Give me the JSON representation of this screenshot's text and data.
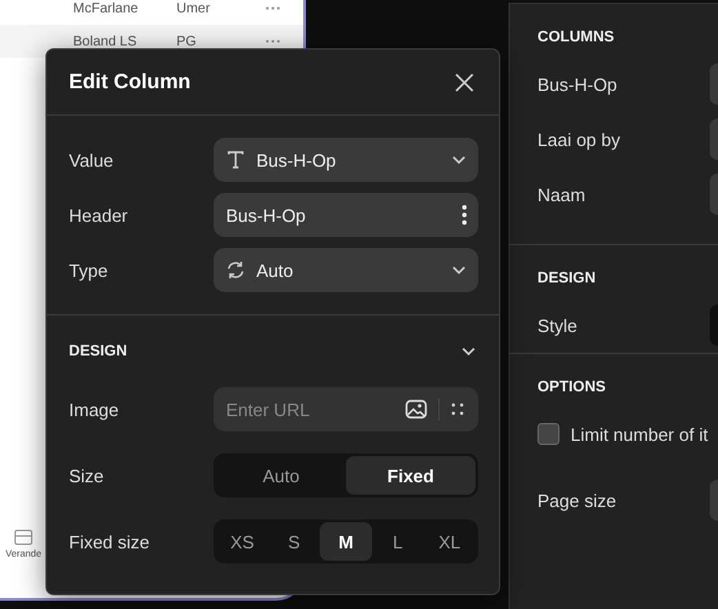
{
  "preview": {
    "rows": [
      {
        "name": "McFarlane",
        "code": "Umer"
      },
      {
        "name": "Boland LS",
        "code": "PG"
      }
    ],
    "tab_label": "Verande"
  },
  "dialog": {
    "title": "Edit Column",
    "fields": [
      {
        "kind": "select",
        "label": "Value",
        "value": "Bus-H-Op"
      },
      {
        "kind": "text",
        "label": "Header",
        "value": "Bus-H-Op"
      },
      {
        "kind": "select",
        "label": "Type",
        "value": "Auto"
      }
    ],
    "design": {
      "heading": "DESIGN",
      "expanded": true,
      "image": {
        "label": "Image",
        "placeholder": "Enter URL"
      },
      "size": {
        "label": "Size",
        "options": [
          {
            "label": "Auto",
            "selected": false
          },
          {
            "label": "Fixed",
            "selected": true
          }
        ]
      },
      "fixed_size": {
        "label": "Fixed size",
        "options": [
          {
            "label": "XS",
            "selected": false
          },
          {
            "label": "S",
            "selected": false
          },
          {
            "label": "M",
            "selected": true
          },
          {
            "label": "L",
            "selected": false
          },
          {
            "label": "XL",
            "selected": false
          }
        ]
      }
    }
  },
  "sidebar": {
    "columns": {
      "heading": "COLUMNS",
      "items": [
        "Bus-H-Op",
        "Laai op by",
        "Naam"
      ]
    },
    "design": {
      "heading": "DESIGN",
      "style_label": "Style"
    },
    "options": {
      "heading": "OPTIONS",
      "limit": {
        "label": "Limit number of it",
        "checked": false
      },
      "page_size_label": "Page size"
    }
  }
}
